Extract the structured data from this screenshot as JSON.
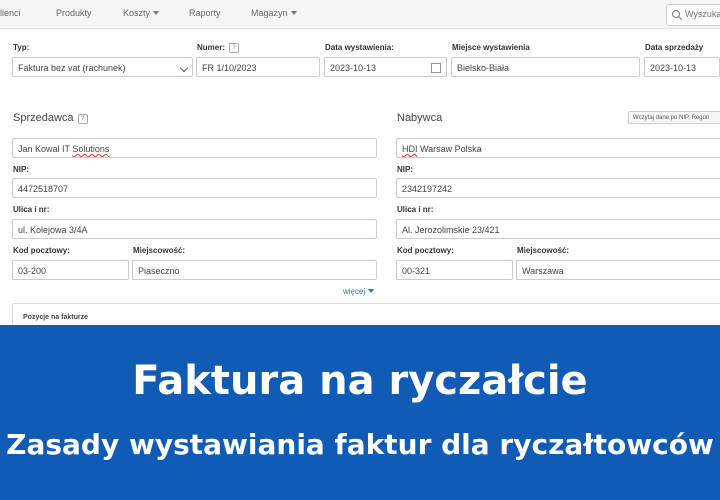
{
  "nav": {
    "items": [
      "Klienci",
      "Produkty",
      "Koszty",
      "Raporty",
      "Magazyn"
    ],
    "search_placeholder": "Wyszukaj"
  },
  "invoice": {
    "type_label": "Typ:",
    "type_value": "Faktura bez vat (rachunek)",
    "number_label": "Numer:",
    "number_value": "FR 1/10/2023",
    "issue_date_label": "Data wystawienia:",
    "issue_date_value": "2023-10-13",
    "place_label": "Miejsce wystawienia",
    "place_value": "Bielsko-Biała",
    "sale_date_label": "Data sprzedaży",
    "sale_date_value": "2023-10-13"
  },
  "seller": {
    "title": "Sprzedawca",
    "name": "Jan Kowal IT Solutions",
    "nip_label": "NIP:",
    "nip": "4472518707",
    "street_label": "Ulica i nr:",
    "street": "ul. Kolejowa 3/4A",
    "zip_label": "Kod pocztowy:",
    "zip": "03-200",
    "city_label": "Miejscowość:",
    "city": "Piaseczno",
    "more_link": "więcej"
  },
  "buyer": {
    "title": "Nabywca",
    "fetch_button": "Wczytaj dane po NIP, Regon",
    "name": "HDI Warsaw Polska",
    "nip_label": "NIP:",
    "nip": "2342197242",
    "street_label": "Ulica i nr:",
    "street": "Al. Jerozolimskie 23/421",
    "zip_label": "Kod pocztowy:",
    "zip": "00-321",
    "city_label": "Miejscowość:",
    "city": "Warszawa"
  },
  "positions": {
    "title": "Pozycje na fakturze"
  },
  "banner": {
    "title": "Faktura na ryczałcie",
    "subtitle": "Zasady wystawiania faktur dla ryczałtowców",
    "color": "#0f5bb5"
  }
}
